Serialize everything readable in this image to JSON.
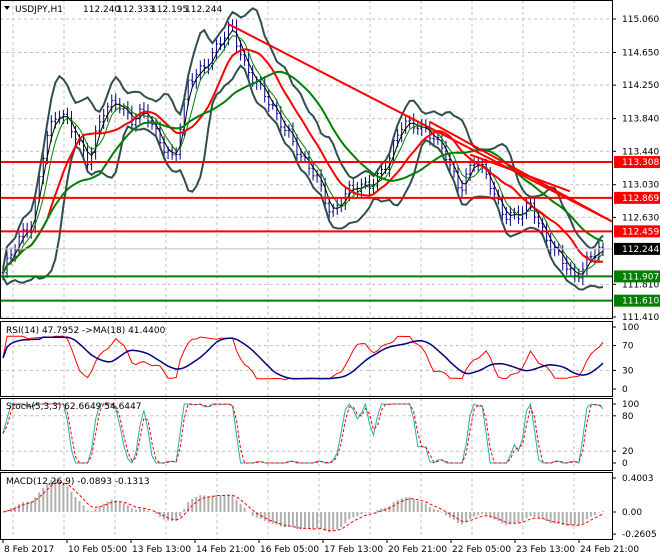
{
  "header": {
    "symbol": "USDJPY,H1",
    "open": "112.240",
    "high": "112.333",
    "low": "112.195",
    "close": "112.244"
  },
  "colors": {
    "bull_bear_bars": "#000080",
    "ma_fast": "#000000",
    "bollinger": "#2f4f4f",
    "ma_red": "#ff0000",
    "ma_green": "#008000",
    "res_line": "#ff0000",
    "sup_line": "#008000"
  },
  "chart_data": [
    {
      "type": "candlestick",
      "title": "USDJPY,H1",
      "timeframe": "H1",
      "x_tick_labels": [
        "8 Feb 2017",
        "10 Feb 05:00",
        "13 Feb 13:00",
        "14 Feb 21:00",
        "16 Feb 05:00",
        "17 Feb 13:00",
        "20 Feb 21:00",
        "22 Feb 05:00",
        "23 Feb 13:00",
        "24 Feb 21:00"
      ],
      "y_tick_labels": [
        "115.060",
        "114.650",
        "114.250",
        "113.840",
        "113.440",
        "113.030",
        "112.630",
        "111.810",
        "111.410"
      ],
      "ylim": [
        111.41,
        115.06
      ],
      "approx_close_path": [
        111.95,
        112.3,
        112.6,
        113.6,
        113.9,
        113.7,
        113.3,
        113.9,
        114.1,
        113.8,
        113.9,
        113.6,
        113.3,
        114.3,
        114.5,
        114.7,
        114.95,
        114.5,
        114.2,
        113.9,
        113.7,
        113.3,
        113.1,
        112.7,
        112.9,
        113.0,
        113.1,
        113.3,
        113.8,
        113.8,
        113.6,
        113.4,
        113.0,
        113.3,
        113.1,
        112.7,
        112.6,
        112.8,
        112.4,
        112.1,
        111.9,
        112.15,
        112.244
      ],
      "current_price": "112.244",
      "resistance_levels": [
        "113.308",
        "112.869",
        "112.459"
      ],
      "support_levels": [
        "111.907",
        "111.610"
      ]
    },
    {
      "type": "line",
      "title": "RSI(14) 47.7952  ->MA(18) 41.4400",
      "y_tick_labels": [
        "100",
        "70",
        "30",
        "0"
      ],
      "ylim": [
        0,
        100
      ],
      "levels": [
        70,
        30
      ]
    },
    {
      "type": "line",
      "title": "Stoch(5,3,3) 62.6649 54.6447",
      "y_tick_labels": [
        "100",
        "80",
        "20",
        "0"
      ],
      "ylim": [
        0,
        100
      ],
      "levels": [
        80,
        20
      ]
    },
    {
      "type": "bar",
      "title": "MACD(12,26,9) -0.0893 -0.1313",
      "y_tick_labels": [
        "0.4003",
        "0.00",
        "-0.2605"
      ],
      "ylim": [
        -0.2605,
        0.4003
      ]
    }
  ]
}
